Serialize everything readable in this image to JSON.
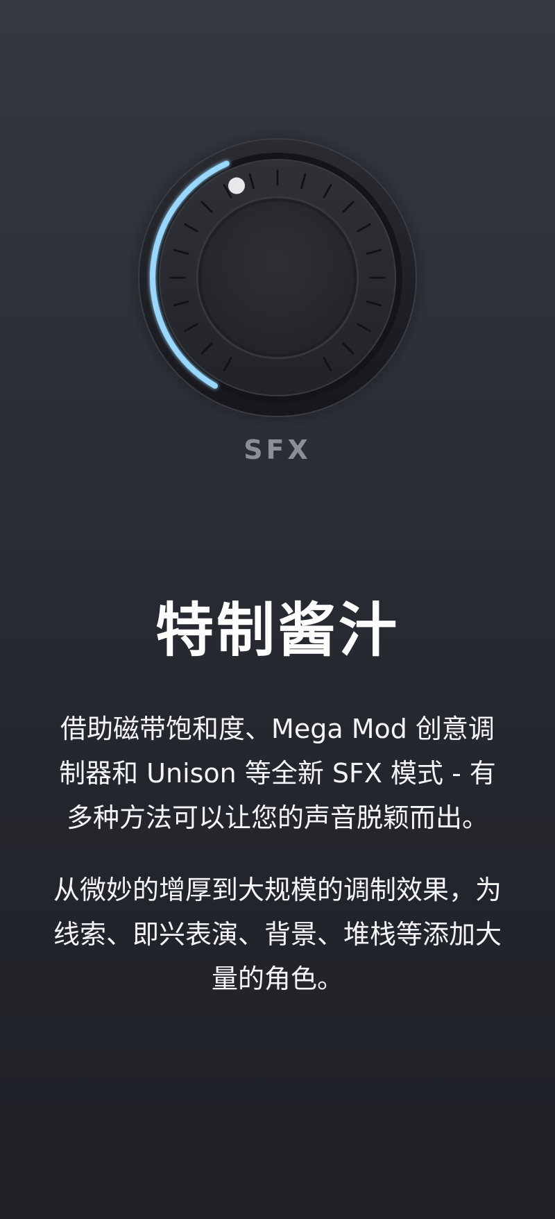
{
  "knob": {
    "label": "SFX",
    "value_fraction": 0.42,
    "arc_color": "#9ad7ff",
    "indicator_color": "#e8e8ea"
  },
  "content": {
    "title": "特制酱汁",
    "paragraph_1": "借助磁带饱和度、Mega Mod 创意调制器和 Unison 等全新 SFX 模式 - 有多种方法可以让您的声音脱颖而出。",
    "paragraph_2": "从微妙的增厚到大规模的调制效果，为线索、即兴表演、背景、堆栈等添加大量的角色。"
  }
}
